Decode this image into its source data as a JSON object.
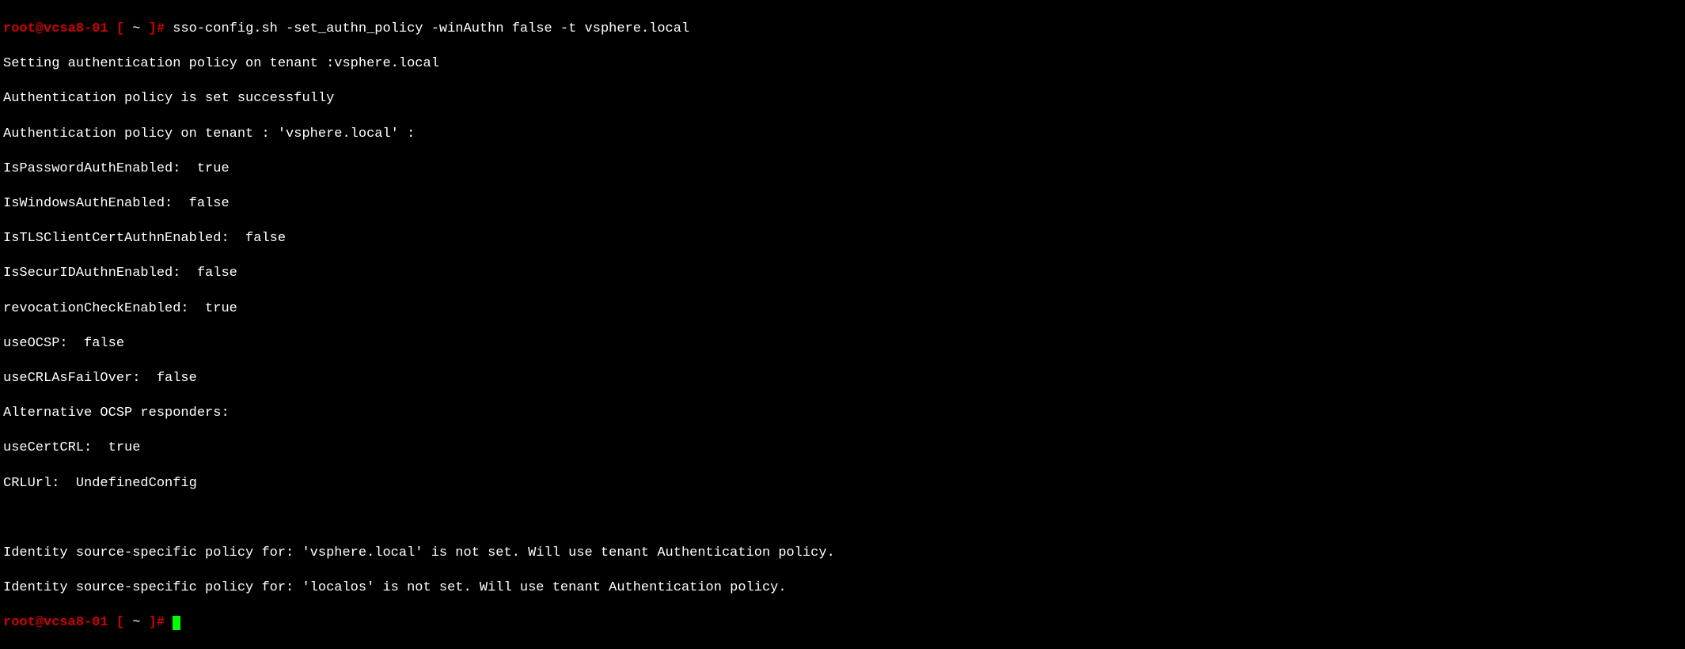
{
  "prompt": {
    "user_host": "root@vcsa8-01",
    "bracket_open": " [ ",
    "tilde": "~",
    "bracket_close": " ]# "
  },
  "command": "sso-config.sh -set_authn_policy -winAuthn false -t vsphere.local",
  "output": {
    "line1": "Setting authentication policy on tenant :vsphere.local",
    "line2": "Authentication policy is set successfully",
    "line3": "Authentication policy on tenant : 'vsphere.local' :",
    "line4": "IsPasswordAuthEnabled:  true",
    "line5": "IsWindowsAuthEnabled:  false",
    "line6": "IsTLSClientCertAuthnEnabled:  false",
    "line7": "IsSecurIDAuthnEnabled:  false",
    "line8": "revocationCheckEnabled:  true",
    "line9": "useOCSP:  false",
    "line10": "useCRLAsFailOver:  false",
    "line11": "Alternative OCSP responders:",
    "line12": "useCertCRL:  true",
    "line13": "CRLUrl:  UndefinedConfig",
    "line14": "",
    "line15": "",
    "line16": "Identity source-specific policy for: 'vsphere.local' is not set. Will use tenant Authentication policy.",
    "line17": "Identity source-specific policy for: 'localos' is not set. Will use tenant Authentication policy."
  }
}
